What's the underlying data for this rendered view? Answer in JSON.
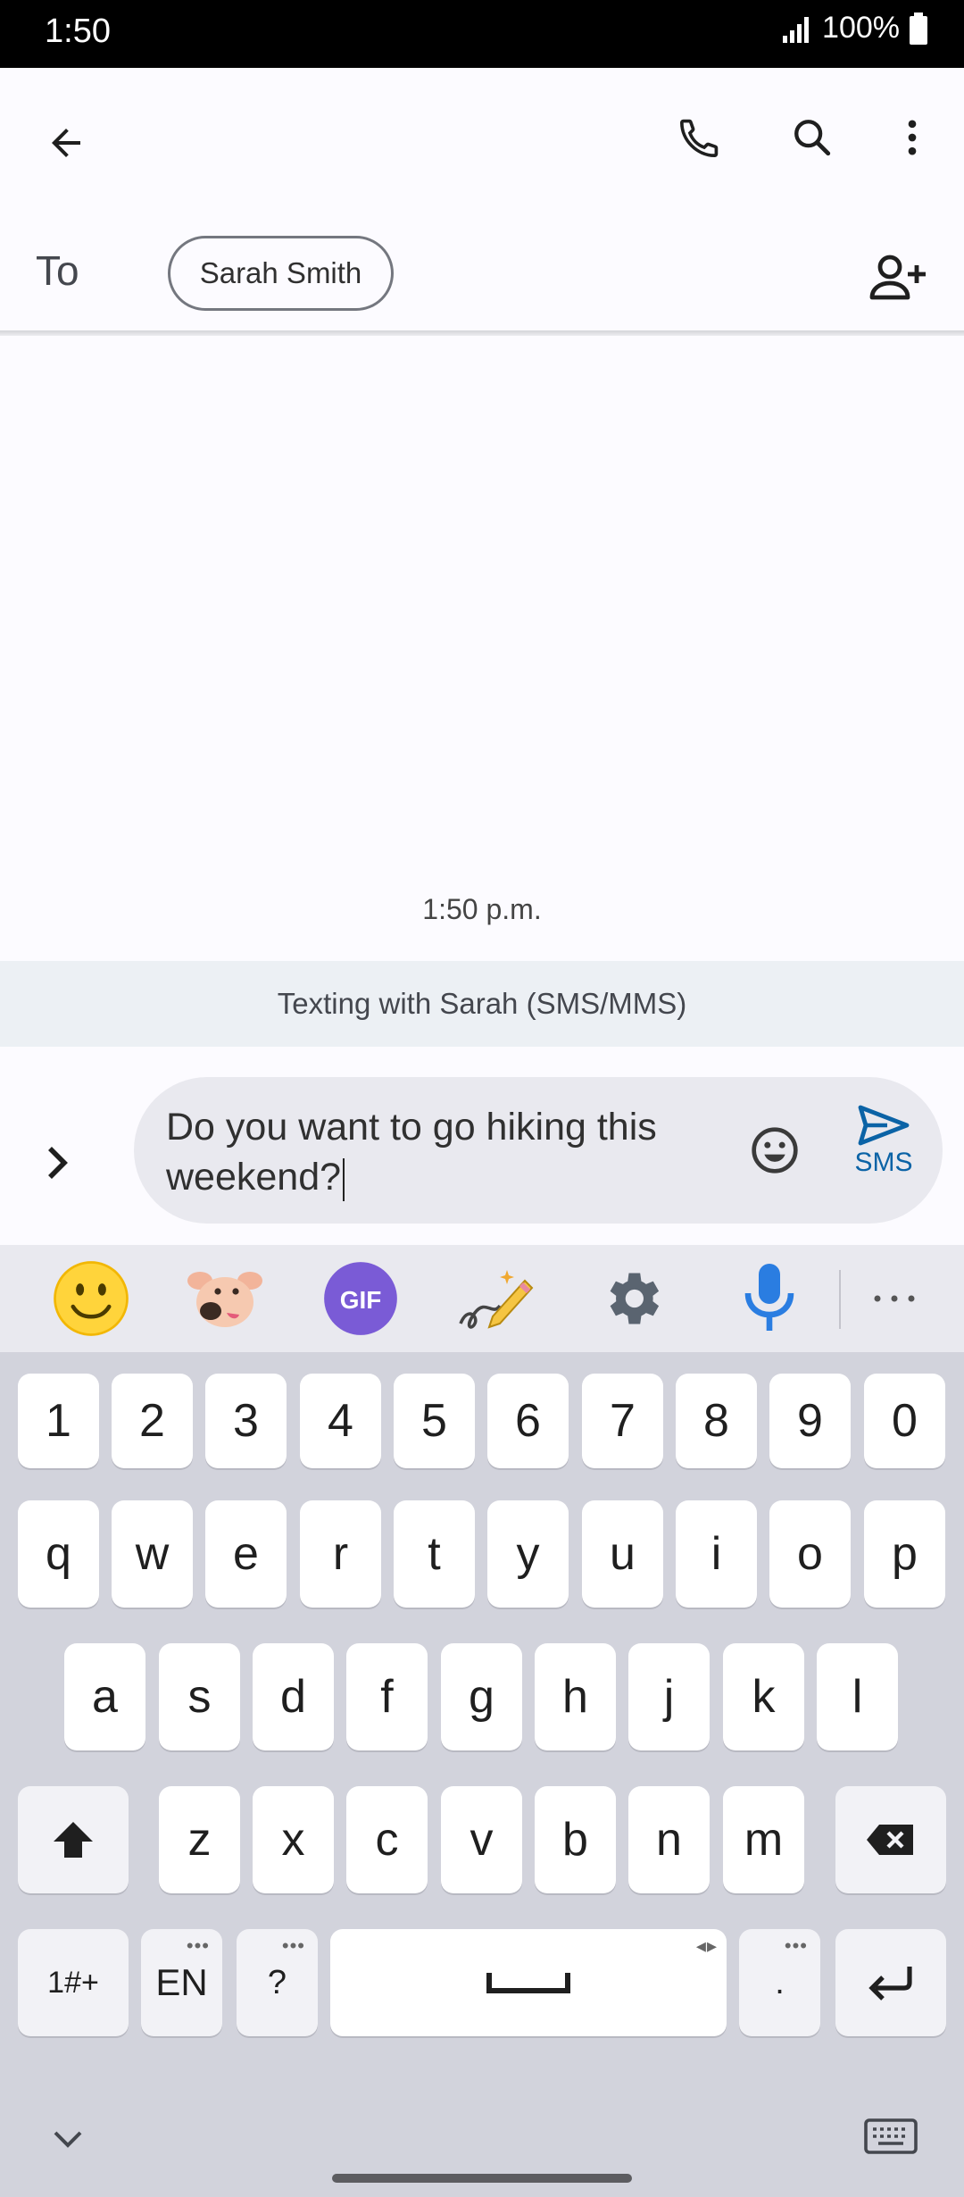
{
  "status_bar": {
    "time": "1:50",
    "battery": "100%"
  },
  "app_bar": {
    "back_icon": "arrow-back-icon",
    "call_icon": "phone-icon",
    "search_icon": "search-icon",
    "menu_icon": "more-vert-icon"
  },
  "recipients": {
    "to_label": "To",
    "chip_name": "Sarah Smith",
    "add_icon": "person-add-icon"
  },
  "conversation": {
    "timestamp": "1:50 p.m.",
    "banner": "Texting with Sarah (SMS/MMS)"
  },
  "compose": {
    "text": "Do you want to go hiking this weekend?",
    "send_label": "SMS",
    "accent": "#0b63a6"
  },
  "keyboard": {
    "suggestions": [
      "emoji-icon",
      "sticker-icon",
      "gif-icon",
      "handwriting-icon",
      "settings-icon",
      "microphone-icon",
      "more-icon"
    ],
    "gif_label": "GIF",
    "row_numbers": [
      "1",
      "2",
      "3",
      "4",
      "5",
      "6",
      "7",
      "8",
      "9",
      "0"
    ],
    "row_top": [
      "q",
      "w",
      "e",
      "r",
      "t",
      "y",
      "u",
      "i",
      "o",
      "p"
    ],
    "row_mid": [
      "a",
      "s",
      "d",
      "f",
      "g",
      "h",
      "j",
      "k",
      "l"
    ],
    "row_bottom": [
      "z",
      "x",
      "c",
      "v",
      "b",
      "n",
      "m"
    ],
    "symbols_label": "1#+",
    "language_label": "EN",
    "question_label": "?",
    "period_label": "."
  }
}
